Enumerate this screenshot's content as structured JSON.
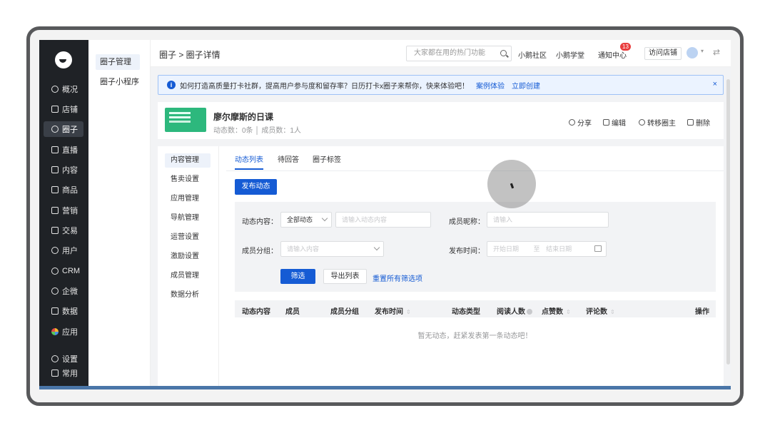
{
  "nav": {
    "items": [
      {
        "label": "概况",
        "icon": "overview-icon"
      },
      {
        "label": "店铺",
        "icon": "store-icon"
      },
      {
        "label": "圈子",
        "icon": "circle-icon"
      },
      {
        "label": "直播",
        "icon": "live-icon"
      },
      {
        "label": "内容",
        "icon": "content-icon"
      },
      {
        "label": "商品",
        "icon": "goods-icon"
      },
      {
        "label": "营销",
        "icon": "marketing-icon"
      },
      {
        "label": "交易",
        "icon": "trade-icon"
      },
      {
        "label": "用户",
        "icon": "user-icon"
      },
      {
        "label": "CRM",
        "icon": "crm-icon"
      },
      {
        "label": "企微",
        "icon": "wecom-icon"
      },
      {
        "label": "数据",
        "icon": "data-icon"
      },
      {
        "label": "应用",
        "icon": "apps-icon"
      },
      {
        "label": "设置",
        "icon": "settings-icon"
      },
      {
        "label": "常用",
        "icon": "favorites-icon"
      }
    ],
    "active": "圈子"
  },
  "subnav": {
    "items": [
      "圈子管理",
      "圈子小程序"
    ]
  },
  "header": {
    "breadcrumb": "圈子 > 圈子详情",
    "search_placeholder": "大家都在用的热门功能",
    "links": [
      "小鹅社区",
      "小鹅学堂",
      "通知中心"
    ],
    "notification_count": "13",
    "visit_store": "访问店铺"
  },
  "notice": {
    "text": "如何打造高质量打卡社群，提高用户参与度和留存率？日历打卡x圈子来帮你，快来体验吧！",
    "link1": "案例体验",
    "link2": "立即创建",
    "close": "×"
  },
  "circle": {
    "title": "廖尔摩斯的日课",
    "meta": "动态数：0条 │ 成员数：1人",
    "actions": [
      "分享",
      "编辑",
      "转移圈主",
      "删除"
    ]
  },
  "side_menu": [
    "内容管理",
    "售卖设置",
    "应用管理",
    "导航管理",
    "运营设置",
    "激励设置",
    "成员管理",
    "数据分析"
  ],
  "tabs": [
    "动态列表",
    "待回答",
    "圈子标签"
  ],
  "publish_button": "发布动态",
  "filter": {
    "content_label": "动态内容：",
    "content_type": "全部动态",
    "content_placeholder": "请输入动态内容",
    "nickname_label": "成员昵称：",
    "nickname_placeholder": "请输入",
    "group_label": "成员分组：",
    "group_placeholder": "请输入内容",
    "time_label": "发布时间：",
    "start_date": "开始日期",
    "to": "至",
    "end_date": "结束日期",
    "filter_button": "筛选",
    "export_button": "导出列表",
    "reset_link": "重置所有筛选项"
  },
  "table": {
    "columns": [
      "动态内容",
      "成员",
      "成员分组",
      "发布时间",
      "动态类型",
      "阅读人数",
      "点赞数",
      "评论数",
      "操作"
    ],
    "empty": "暂无动态，赶紧发表第一条动态吧！"
  },
  "colors": {
    "accent": "#155bd4",
    "nav_bg": "#1f2226",
    "badge": "#e93d3d"
  }
}
